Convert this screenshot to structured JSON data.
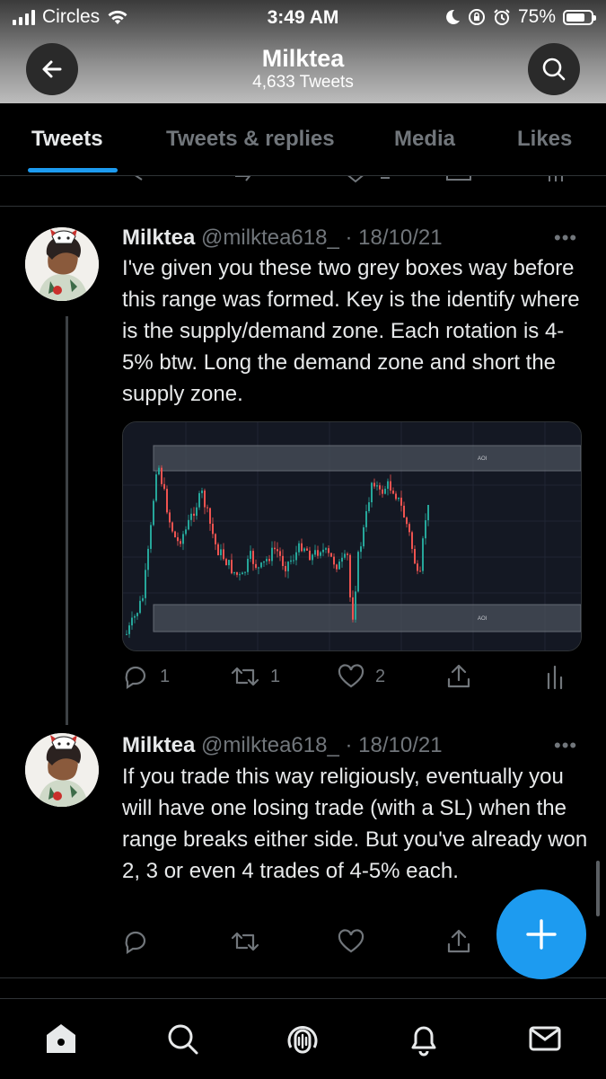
{
  "status_bar": {
    "carrier": "Circles",
    "time": "3:49 AM",
    "battery": "75%",
    "battery_level": 0.75
  },
  "header": {
    "name": "Milktea",
    "tweet_count": "4,633 Tweets",
    "back_icon": "arrow-left-icon",
    "search_icon": "search-icon"
  },
  "tabs": [
    {
      "label": "Tweets",
      "active": true
    },
    {
      "label": "Tweets & replies",
      "active": false
    },
    {
      "label": "Media",
      "active": false
    },
    {
      "label": "Likes",
      "active": false
    }
  ],
  "tweets": [
    {
      "name": "Milktea",
      "handle": "@milktea618_",
      "date": "· 18/10/21",
      "more": "•••",
      "text": "I've given you these two grey boxes way before this range was formed. Key is the identify where is the supply/demand zone. Each rotation is 4-5% btw. Long the demand zone and short the supply zone.",
      "media": {
        "top_zone_label": "AOI",
        "bottom_zone_label": "AOI"
      },
      "replies": "1",
      "retweets": "1",
      "likes": "2"
    },
    {
      "name": "Milktea",
      "handle": "@milktea618_",
      "date": "· 18/10/21",
      "more": "•••",
      "text": "If you trade this way religiously, eventually you will have one losing trade (with a SL) when the range breaks either side. But you've already won 2, 3 or even 4 trades of 4-5% each.",
      "replies": "",
      "retweets": "",
      "likes": ""
    }
  ],
  "colors": {
    "accent": "#1d9bf0",
    "background": "#000000",
    "muted": "#71767b"
  },
  "bottom_nav": [
    "home-icon",
    "search-icon",
    "spaces-icon",
    "notifications-icon",
    "messages-icon"
  ]
}
